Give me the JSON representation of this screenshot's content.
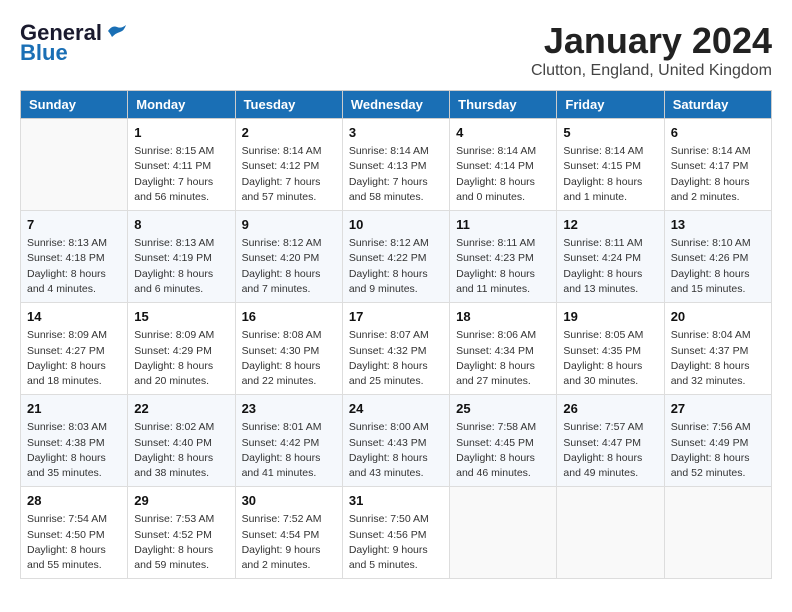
{
  "header": {
    "logo_general": "General",
    "logo_blue": "Blue",
    "month_title": "January 2024",
    "location": "Clutton, England, United Kingdom"
  },
  "days_of_week": [
    "Sunday",
    "Monday",
    "Tuesday",
    "Wednesday",
    "Thursday",
    "Friday",
    "Saturday"
  ],
  "weeks": [
    [
      {
        "day": "",
        "info": ""
      },
      {
        "day": "1",
        "info": "Sunrise: 8:15 AM\nSunset: 4:11 PM\nDaylight: 7 hours\nand 56 minutes."
      },
      {
        "day": "2",
        "info": "Sunrise: 8:14 AM\nSunset: 4:12 PM\nDaylight: 7 hours\nand 57 minutes."
      },
      {
        "day": "3",
        "info": "Sunrise: 8:14 AM\nSunset: 4:13 PM\nDaylight: 7 hours\nand 58 minutes."
      },
      {
        "day": "4",
        "info": "Sunrise: 8:14 AM\nSunset: 4:14 PM\nDaylight: 8 hours\nand 0 minutes."
      },
      {
        "day": "5",
        "info": "Sunrise: 8:14 AM\nSunset: 4:15 PM\nDaylight: 8 hours\nand 1 minute."
      },
      {
        "day": "6",
        "info": "Sunrise: 8:14 AM\nSunset: 4:17 PM\nDaylight: 8 hours\nand 2 minutes."
      }
    ],
    [
      {
        "day": "7",
        "info": "Sunrise: 8:13 AM\nSunset: 4:18 PM\nDaylight: 8 hours\nand 4 minutes."
      },
      {
        "day": "8",
        "info": "Sunrise: 8:13 AM\nSunset: 4:19 PM\nDaylight: 8 hours\nand 6 minutes."
      },
      {
        "day": "9",
        "info": "Sunrise: 8:12 AM\nSunset: 4:20 PM\nDaylight: 8 hours\nand 7 minutes."
      },
      {
        "day": "10",
        "info": "Sunrise: 8:12 AM\nSunset: 4:22 PM\nDaylight: 8 hours\nand 9 minutes."
      },
      {
        "day": "11",
        "info": "Sunrise: 8:11 AM\nSunset: 4:23 PM\nDaylight: 8 hours\nand 11 minutes."
      },
      {
        "day": "12",
        "info": "Sunrise: 8:11 AM\nSunset: 4:24 PM\nDaylight: 8 hours\nand 13 minutes."
      },
      {
        "day": "13",
        "info": "Sunrise: 8:10 AM\nSunset: 4:26 PM\nDaylight: 8 hours\nand 15 minutes."
      }
    ],
    [
      {
        "day": "14",
        "info": "Sunrise: 8:09 AM\nSunset: 4:27 PM\nDaylight: 8 hours\nand 18 minutes."
      },
      {
        "day": "15",
        "info": "Sunrise: 8:09 AM\nSunset: 4:29 PM\nDaylight: 8 hours\nand 20 minutes."
      },
      {
        "day": "16",
        "info": "Sunrise: 8:08 AM\nSunset: 4:30 PM\nDaylight: 8 hours\nand 22 minutes."
      },
      {
        "day": "17",
        "info": "Sunrise: 8:07 AM\nSunset: 4:32 PM\nDaylight: 8 hours\nand 25 minutes."
      },
      {
        "day": "18",
        "info": "Sunrise: 8:06 AM\nSunset: 4:34 PM\nDaylight: 8 hours\nand 27 minutes."
      },
      {
        "day": "19",
        "info": "Sunrise: 8:05 AM\nSunset: 4:35 PM\nDaylight: 8 hours\nand 30 minutes."
      },
      {
        "day": "20",
        "info": "Sunrise: 8:04 AM\nSunset: 4:37 PM\nDaylight: 8 hours\nand 32 minutes."
      }
    ],
    [
      {
        "day": "21",
        "info": "Sunrise: 8:03 AM\nSunset: 4:38 PM\nDaylight: 8 hours\nand 35 minutes."
      },
      {
        "day": "22",
        "info": "Sunrise: 8:02 AM\nSunset: 4:40 PM\nDaylight: 8 hours\nand 38 minutes."
      },
      {
        "day": "23",
        "info": "Sunrise: 8:01 AM\nSunset: 4:42 PM\nDaylight: 8 hours\nand 41 minutes."
      },
      {
        "day": "24",
        "info": "Sunrise: 8:00 AM\nSunset: 4:43 PM\nDaylight: 8 hours\nand 43 minutes."
      },
      {
        "day": "25",
        "info": "Sunrise: 7:58 AM\nSunset: 4:45 PM\nDaylight: 8 hours\nand 46 minutes."
      },
      {
        "day": "26",
        "info": "Sunrise: 7:57 AM\nSunset: 4:47 PM\nDaylight: 8 hours\nand 49 minutes."
      },
      {
        "day": "27",
        "info": "Sunrise: 7:56 AM\nSunset: 4:49 PM\nDaylight: 8 hours\nand 52 minutes."
      }
    ],
    [
      {
        "day": "28",
        "info": "Sunrise: 7:54 AM\nSunset: 4:50 PM\nDaylight: 8 hours\nand 55 minutes."
      },
      {
        "day": "29",
        "info": "Sunrise: 7:53 AM\nSunset: 4:52 PM\nDaylight: 8 hours\nand 59 minutes."
      },
      {
        "day": "30",
        "info": "Sunrise: 7:52 AM\nSunset: 4:54 PM\nDaylight: 9 hours\nand 2 minutes."
      },
      {
        "day": "31",
        "info": "Sunrise: 7:50 AM\nSunset: 4:56 PM\nDaylight: 9 hours\nand 5 minutes."
      },
      {
        "day": "",
        "info": ""
      },
      {
        "day": "",
        "info": ""
      },
      {
        "day": "",
        "info": ""
      }
    ]
  ]
}
